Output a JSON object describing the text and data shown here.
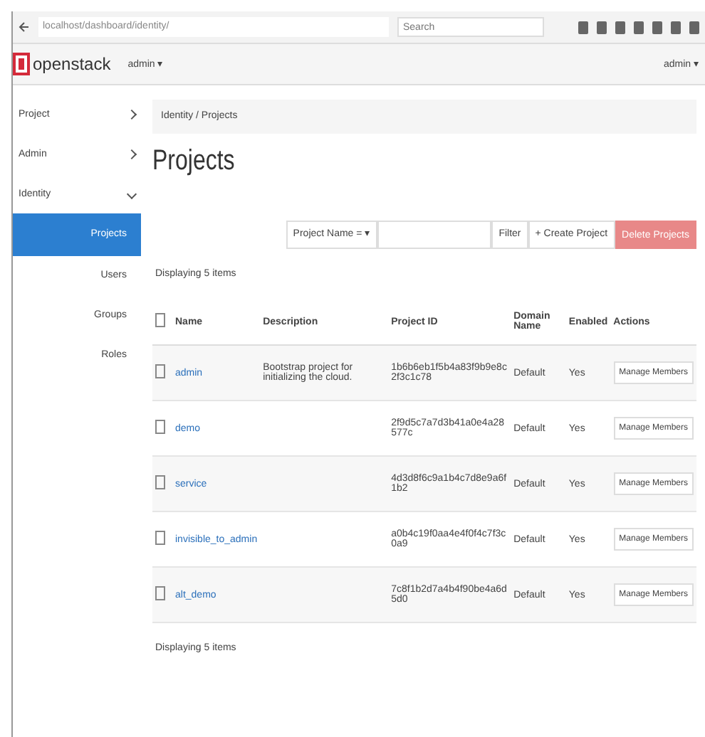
{
  "browser": {
    "url": "localhost/dashboard/identity/",
    "search_placeholder": "Search"
  },
  "header": {
    "logo": "openstack",
    "project_menu": "admin ▾",
    "user_menu": "admin ▾"
  },
  "sidebar": {
    "items": [
      {
        "label": "Project",
        "expanded": false
      },
      {
        "label": "Admin",
        "expanded": false
      },
      {
        "label": "Identity",
        "expanded": true,
        "children": [
          {
            "label": "Projects",
            "selected": true
          },
          {
            "label": "Users",
            "selected": false
          },
          {
            "label": "Groups",
            "selected": false
          },
          {
            "label": "Roles",
            "selected": false
          }
        ]
      }
    ]
  },
  "breadcrumb": "Identity / Projects",
  "page_title": "Projects",
  "toolbar": {
    "filter_select": "Project Name = ▾",
    "filter_button": "Filter",
    "create_button": "+ Create Project",
    "delete_button": "Delete Projects"
  },
  "count_top": "Displaying 5 items",
  "table": {
    "select_all_checked": false,
    "columns": [
      "Name",
      "Description",
      "Project ID",
      "Domain Name",
      "Enabled",
      "Actions"
    ],
    "rows": [
      {
        "checked": false,
        "name": "admin",
        "description": "Bootstrap project for initializing the cloud.",
        "project_id": "1b6b6eb1f5b4a83f9b9e8c2f3c1c78",
        "domain": "Default",
        "enabled": "Yes",
        "action": "Manage Members"
      },
      {
        "checked": false,
        "name": "demo",
        "description": "",
        "project_id": "2f9d5c7a7d3b41a0e4a28577c",
        "domain": "Default",
        "enabled": "Yes",
        "action": "Manage Members"
      },
      {
        "checked": false,
        "name": "service",
        "description": "",
        "project_id": "4d3d8f6c9a1b4c7d8e9a6f1b2",
        "domain": "Default",
        "enabled": "Yes",
        "action": "Manage Members"
      },
      {
        "checked": false,
        "name": "invisible_to_admin",
        "description": "",
        "project_id": "a0b4c19f0aa4e4f0f4c7f3c0a9",
        "domain": "Default",
        "enabled": "Yes",
        "action": "Manage Members"
      },
      {
        "checked": false,
        "name": "alt_demo",
        "description": "",
        "project_id": "7c8f1b2d7a4b4f90be4a6d5d0",
        "domain": "Default",
        "enabled": "Yes",
        "action": "Manage Members"
      }
    ]
  },
  "count_bottom": "Displaying 5 items"
}
